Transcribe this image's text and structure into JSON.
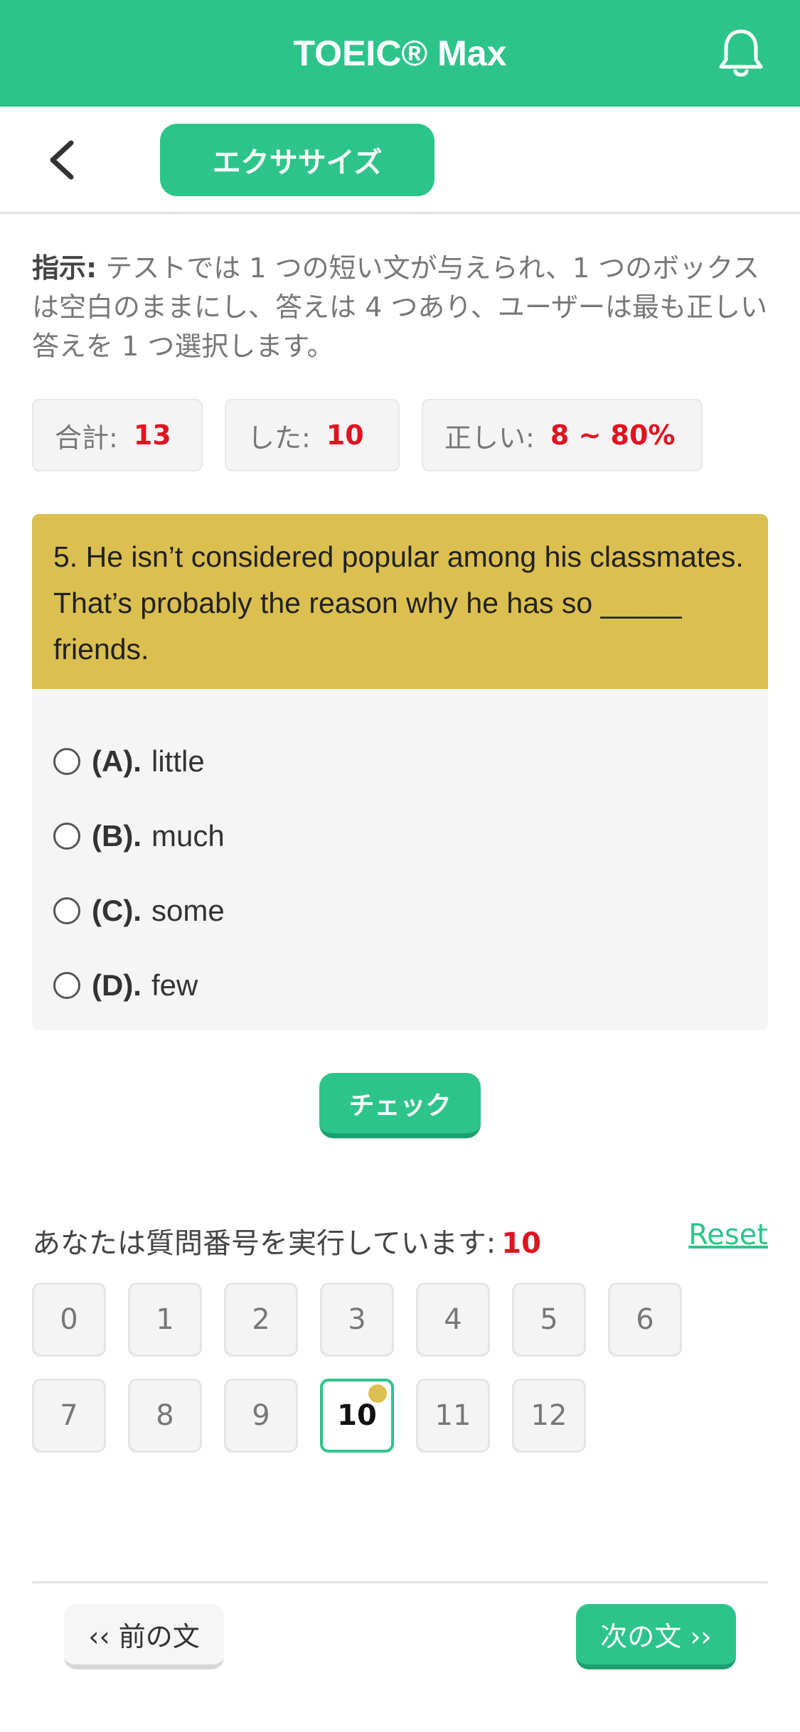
{
  "header": {
    "title": "TOEIC® Max",
    "bell_icon": "bell-icon"
  },
  "subheader": {
    "back_icon": "chevron-left-icon",
    "tab_label": "エクササイズ"
  },
  "instructions": {
    "label": "指示:",
    "text": " テストでは 1 つの短い文が与えられ、1 つのボックスは空白のままにし、答えは 4 つあり、ユーザーは最も正しい答えを 1 つ選択します。"
  },
  "stats": {
    "total_label": "合計:",
    "total_value": "13",
    "done_label": "した:",
    "done_value": "10",
    "correct_label": "正しい:",
    "correct_value": "8 ~ 80%"
  },
  "question": {
    "text": "5. He isn’t considered popular among his classmates. That’s probably the reason why he has so _____ friends.",
    "options": [
      {
        "letter": "(A).",
        "text": "little"
      },
      {
        "letter": "(B).",
        "text": "much"
      },
      {
        "letter": "(C).",
        "text": "some"
      },
      {
        "letter": "(D).",
        "text": "few"
      }
    ]
  },
  "check_label": "チェック",
  "progress": {
    "label": "あなたは質問番号を実行しています:",
    "current": "10",
    "reset_label": "Reset",
    "numbers": [
      "0",
      "1",
      "2",
      "3",
      "4",
      "5",
      "6",
      "7",
      "8",
      "9",
      "10",
      "11",
      "12"
    ]
  },
  "nav": {
    "prev_label": "‹‹ 前の文",
    "next_label": "次の文 ››"
  },
  "colors": {
    "accent": "#2DC48B",
    "question_bg": "#DBBF50",
    "highlight_red": "#e0131f"
  }
}
